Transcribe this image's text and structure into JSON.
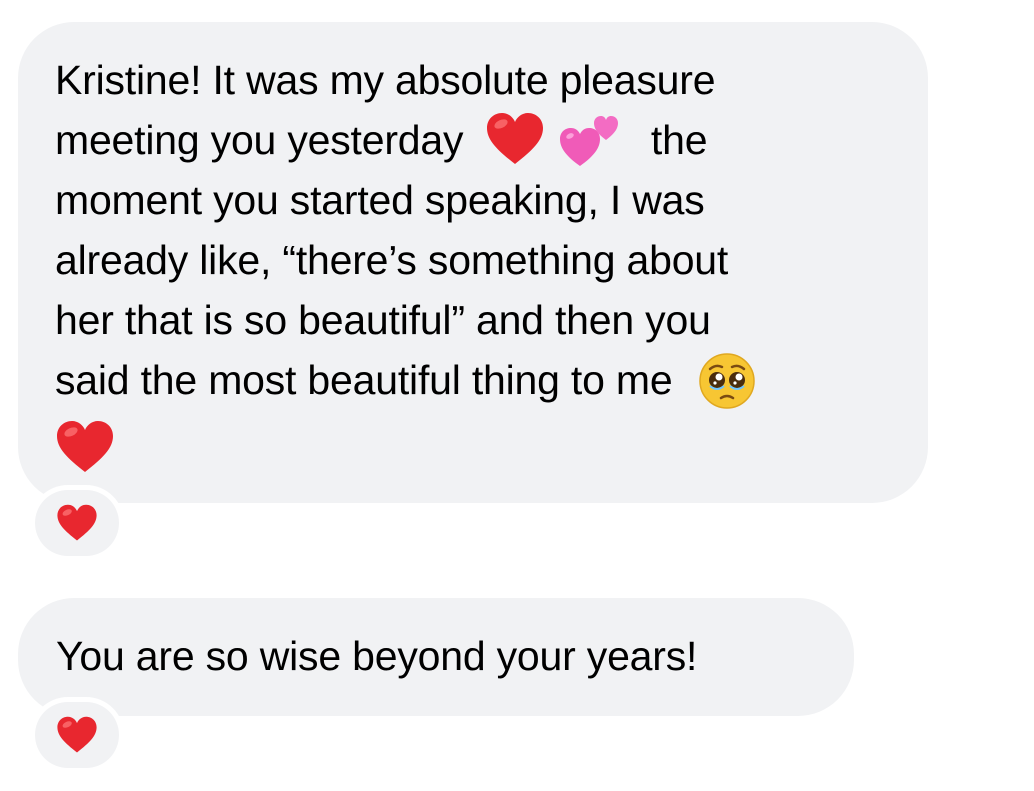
{
  "messages": [
    {
      "lines": [
        "Kristine! It was my absolute pleasure",
        "meeting you yesterday",
        "the",
        "moment you started speaking, I was",
        "already like, “there’s something about",
        "her that is so beautiful” and then you",
        "said the most beautiful thing to me"
      ],
      "emojis": [
        "red-heart",
        "two-hearts",
        "pleading-face",
        "red-heart"
      ],
      "reaction": "red-heart"
    },
    {
      "text": "You are so wise beyond your years!",
      "reaction": "red-heart"
    }
  ],
  "colors": {
    "bubble": "#f1f2f4",
    "heart": "#e8272f",
    "pink_heart": "#f05bb8",
    "face": "#f7c633"
  }
}
